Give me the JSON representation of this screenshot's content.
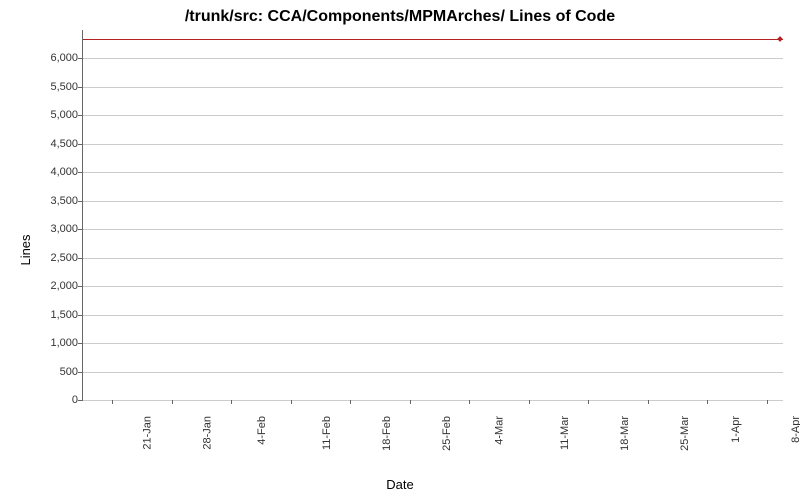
{
  "chart_data": {
    "type": "line",
    "title": "/trunk/src: CCA/Components/MPMArches/ Lines of Code",
    "xlabel": "Date",
    "ylabel": "Lines",
    "ylim": [
      0,
      6500
    ],
    "y_ticks": [
      0,
      500,
      1000,
      1500,
      2000,
      2500,
      3000,
      3500,
      4000,
      4500,
      5000,
      5500,
      6000
    ],
    "y_tick_labels": [
      "0",
      "500",
      "1,000",
      "1,500",
      "2,000",
      "2,500",
      "3,000",
      "3,500",
      "4,000",
      "4,500",
      "5,000",
      "5,500",
      "6,000"
    ],
    "x_tick_labels": [
      "21-Jan",
      "28-Jan",
      "4-Feb",
      "11-Feb",
      "18-Feb",
      "25-Feb",
      "4-Mar",
      "11-Mar",
      "18-Mar",
      "25-Mar",
      "1-Apr",
      "8-Apr"
    ],
    "categories": [
      "21-Jan",
      "28-Jan",
      "4-Feb",
      "11-Feb",
      "18-Feb",
      "25-Feb",
      "4-Mar",
      "11-Mar",
      "18-Mar",
      "25-Mar",
      "1-Apr",
      "8-Apr"
    ],
    "values": [
      6350,
      6350,
      6350,
      6350,
      6350,
      6350,
      6350,
      6350,
      6350,
      6350,
      6350,
      6350
    ],
    "series": [
      {
        "name": "Lines of Code",
        "color": "#b22222",
        "values": [
          6350,
          6350,
          6350,
          6350,
          6350,
          6350,
          6350,
          6350,
          6350,
          6350,
          6350,
          6350
        ]
      }
    ]
  }
}
